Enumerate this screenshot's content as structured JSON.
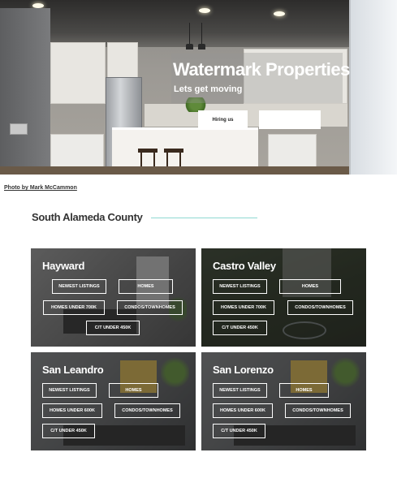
{
  "hero": {
    "title": "Watermark Properties",
    "subtitle": "Lets get moving",
    "hiring_button": "Hiring us",
    "second_button": ""
  },
  "photo_credit": "Photo by Mark McCammon",
  "section": {
    "title": "South Alameda County",
    "accent_color": "#8fd8d2"
  },
  "cards": [
    {
      "title": "Hayward",
      "links": [
        "NEWEST LISTINGS",
        "HOMES",
        "HOMES UNDER 700K",
        "CONDOS/TOWNHOMES",
        "C/T UNDER 450K"
      ]
    },
    {
      "title": "Castro Valley",
      "links": [
        "NEWEST LISTINGS",
        "HOMES",
        "HOMES UNDER 700K",
        "CONDOS/TOWNHOMES",
        "C/T UNDER 450K"
      ]
    },
    {
      "title": "San Leandro",
      "links": [
        "NEWEST LISTINGS",
        "HOMES",
        "HOMES UNDER 600K",
        "CONDOS/TOWNHOMES",
        "C/T UNDER 450K"
      ]
    },
    {
      "title": "San Lorenzo",
      "links": [
        "NEWEST LISTINGS",
        "HOMES",
        "HOMES UNDER 600K",
        "CONDOS/TOWNHOMES",
        "C/T UNDER 450K"
      ]
    }
  ]
}
